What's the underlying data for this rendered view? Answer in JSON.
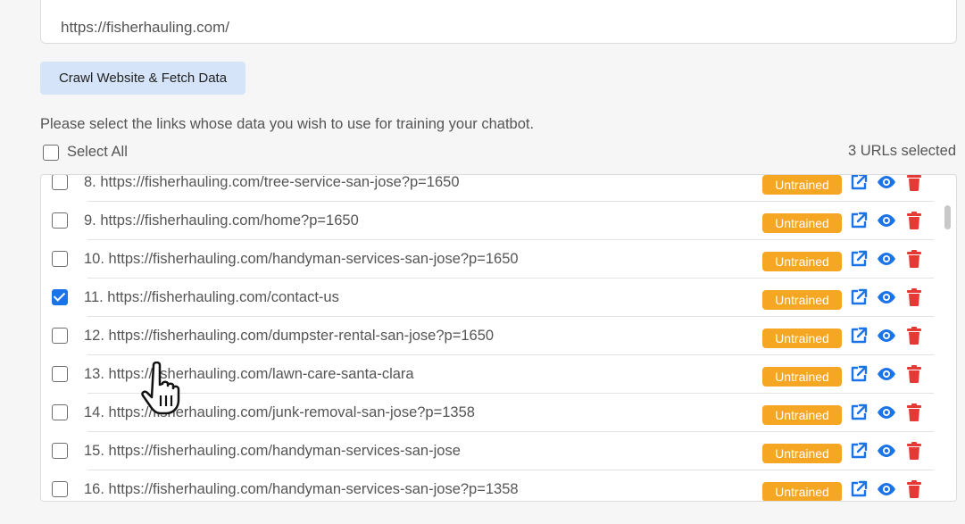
{
  "url_input": {
    "value": "https://fisherhauling.com/"
  },
  "crawl_button": {
    "label": "Crawl Website & Fetch Data"
  },
  "instruction": "Please select the links whose data you wish to use for training your chatbot.",
  "select_all": {
    "label": "Select All",
    "checked": false
  },
  "selected_count": "3 URLs selected",
  "colors": {
    "badge": "#f5a623",
    "icon_blue": "#1a73e8",
    "icon_red": "#e53935",
    "button_bg": "#d5e4f8"
  },
  "links": [
    {
      "text": "8. https://fisherhauling.com/tree-service-san-jose?p=1650",
      "status": "Untrained",
      "checked": false
    },
    {
      "text": "9. https://fisherhauling.com/home?p=1650",
      "status": "Untrained",
      "checked": false
    },
    {
      "text": "10. https://fisherhauling.com/handyman-services-san-jose?p=1650",
      "status": "Untrained",
      "checked": false
    },
    {
      "text": "11. https://fisherhauling.com/contact-us",
      "status": "Untrained",
      "checked": true
    },
    {
      "text": "12. https://fisherhauling.com/dumpster-rental-san-jose?p=1650",
      "status": "Untrained",
      "checked": false
    },
    {
      "text": "13. https://fisherhauling.com/lawn-care-santa-clara",
      "status": "Untrained",
      "checked": false
    },
    {
      "text": "14. https://fisherhauling.com/junk-removal-san-jose?p=1358",
      "status": "Untrained",
      "checked": false
    },
    {
      "text": "15. https://fisherhauling.com/handyman-services-san-jose",
      "status": "Untrained",
      "checked": false
    },
    {
      "text": "16. https://fisherhauling.com/handyman-services-san-jose?p=1358",
      "status": "Untrained",
      "checked": false
    }
  ],
  "row_icons": [
    "external-link-icon",
    "eye-icon",
    "trash-icon"
  ]
}
